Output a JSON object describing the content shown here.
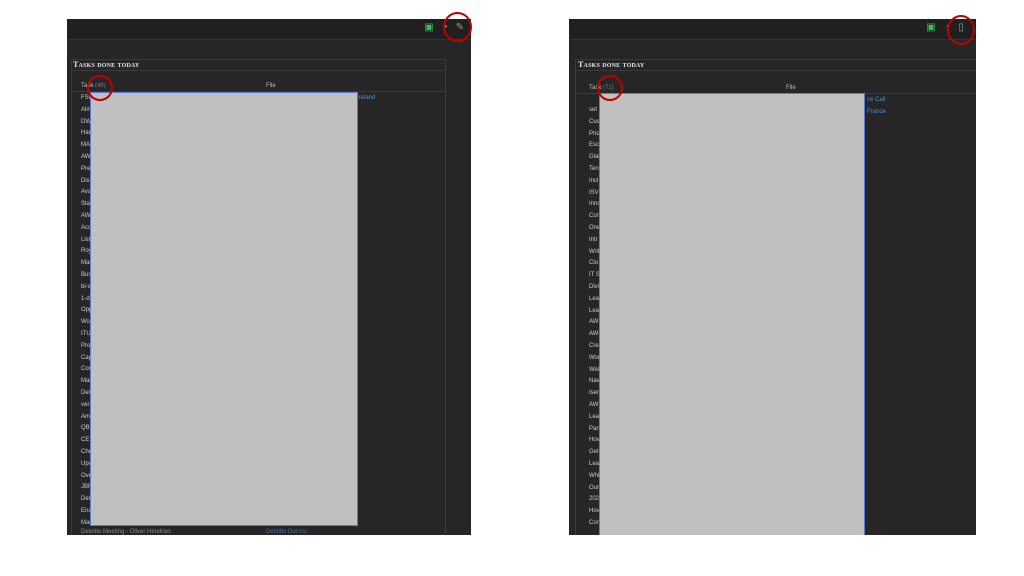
{
  "left": {
    "section_title": "Tasks done today",
    "col_task": "Task",
    "col_task_count": "(48)",
    "col_file": "File",
    "links": [
      "Ireland",
      "Deloitte Dot Inc"
    ],
    "bottom_row": "Deloitte Meeting - Oliver Hendries",
    "row_prefixes": [
      "FSI",
      "Alm",
      "DW",
      "Han",
      "MAF",
      "AWS",
      "Prep",
      "Disc",
      "Avai",
      "Stat",
      "AWS",
      "Acco",
      "List",
      "Roy",
      "Man",
      "Busi",
      "bl-w",
      "1-da",
      "Opp",
      "Wor",
      "ITUp",
      "Proc",
      "Cap",
      "Com",
      "Mair",
      "Delo",
      "vers",
      "Amb",
      "QBR",
      "CE A",
      "Che",
      "Upc",
      "Over",
      "JBR",
      "Delo",
      "Enat",
      "Mar"
    ],
    "icons": [
      "clipboard-icon",
      "clock-icon",
      "pencil-icon"
    ]
  },
  "right": {
    "section_title": "Tasks done today",
    "col_task": "Task",
    "col_task_count": "(71)",
    "col_file": "File",
    "links": [
      "ce Cali",
      "France"
    ],
    "row_prefixes": [
      "set",
      "Cus",
      "Pric",
      "Esc",
      "Glai",
      "Ten",
      "Incl",
      "ISV",
      "Inno",
      "Con",
      "One",
      "Intr",
      "Writ",
      "Clo",
      "IT S",
      "Divi",
      "Lea",
      "Lea",
      "AW",
      "AW",
      "Cre",
      "Wor",
      "Wel",
      "Nav",
      "Iser",
      "AW",
      "Lea",
      "Part",
      "Hov",
      "Get",
      "Lea",
      "Whi",
      "Our",
      "202",
      "Hov",
      "Con"
    ],
    "icons": [
      "clipboard-icon",
      "clock-icon",
      "book-icon"
    ]
  }
}
